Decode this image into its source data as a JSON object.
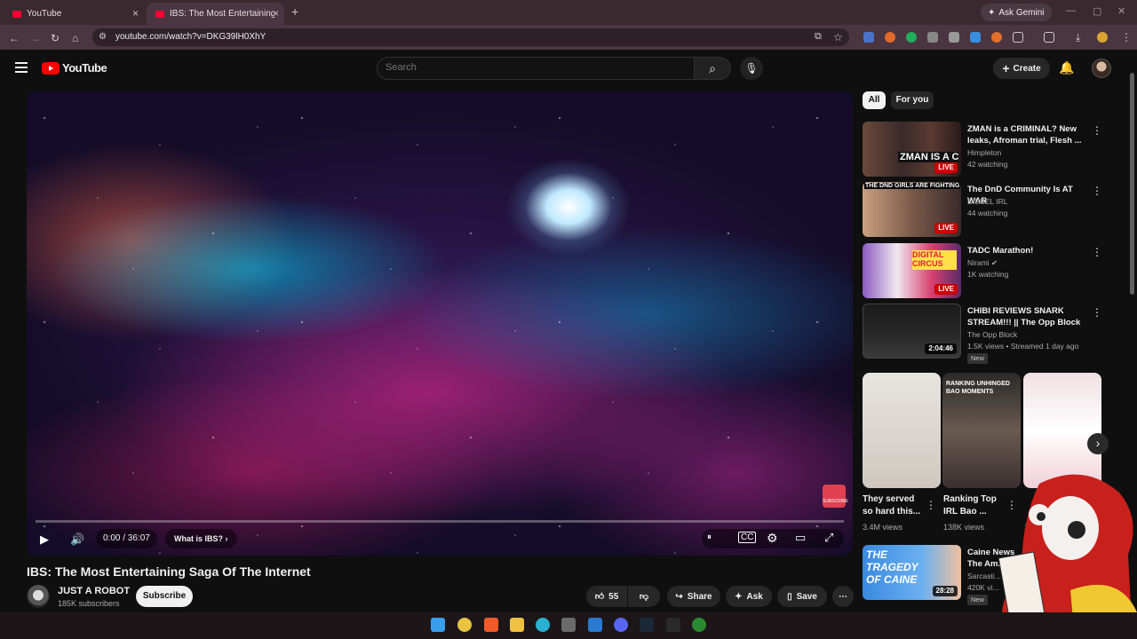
{
  "browser": {
    "tabs": [
      {
        "label": "YouTube"
      },
      {
        "label": "IBS: The Most Entertaining Saga"
      }
    ],
    "url": "youtube.com/watch?v=DKG39lH0XhY",
    "ask_gemini": "Ask Gemini"
  },
  "header": {
    "logo_text": "YouTube",
    "search_placeholder": "Search",
    "create_label": "Create"
  },
  "player": {
    "time": "0:00 / 36:07",
    "chapter": "What is IBS?",
    "progress": 0,
    "watermark": "SUBSCRIBE"
  },
  "video": {
    "title": "IBS: The Most Entertaining Saga Of The Internet",
    "channel": "JUST A ROBOT",
    "subscribers": "185K subscribers",
    "subscribe_label": "Subscribe",
    "likes": "55",
    "share_label": "Share",
    "ask_label": "Ask",
    "save_label": "Save"
  },
  "sidebar": {
    "chips": [
      "All",
      "For you"
    ],
    "recs": [
      {
        "title": "ZMAN is a CRIMINAL? New leaks, Afroman trial, Flesh ...",
        "channel": "Himpleton",
        "meta": "42 watching",
        "badge": "LIVE",
        "thumb_text": "ZMAN IS A CRIMI"
      },
      {
        "title": "The DnD Community Is AT WAR",
        "channel": "DIESEL IRL",
        "meta": "44 watching",
        "badge": "LIVE",
        "thumb_text": "THE DND GIRLS ARE FIGHTING"
      },
      {
        "title": "TADC Marathon!",
        "channel": "Nirami",
        "meta": "1K watching",
        "badge": "LIVE",
        "thumb_text": "DIGITAL CIRCUS"
      },
      {
        "title": "CHIBI REVIEWS SNARK STREAM!!! || The Opp Block",
        "channel": "The Opp Block",
        "meta": "1.5K views • Streamed 1 day ago",
        "badge": "2:04:46",
        "new": "New"
      }
    ],
    "shorts": [
      {
        "title": "They served so hard this...",
        "views": "3.4M views"
      },
      {
        "title": "Ranking Top IRL Bao ...",
        "views": "138K views",
        "thumb_text": "RANKING UNHINGED BAO MOMENTS"
      },
      {
        "title": "",
        "views": "1..."
      }
    ],
    "last_rec": {
      "title": "Caine News The Am...",
      "channel": "Sarcasti...",
      "meta": "420K vi...",
      "badge": "28:28",
      "new": "New",
      "thumb_text": "THE TRAGEDY OF CAINE"
    }
  },
  "colors": {
    "accent": "#ff0000",
    "live": "#cc0000",
    "bg": "#0f0f0f"
  }
}
